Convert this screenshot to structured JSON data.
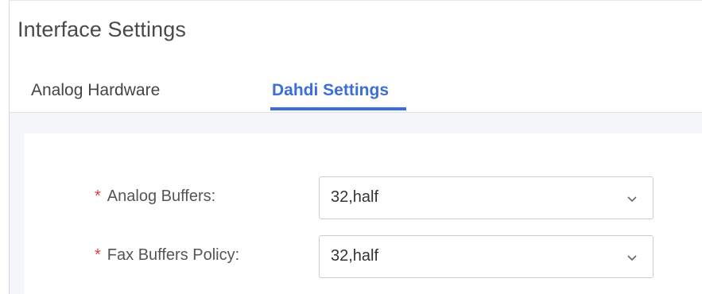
{
  "page": {
    "title": "Interface Settings"
  },
  "tabs": [
    {
      "label": "Analog Hardware",
      "active": false
    },
    {
      "label": "Dahdi Settings",
      "active": true
    }
  ],
  "form": {
    "required_mark": "*",
    "fields": [
      {
        "label": "Analog Buffers:",
        "value": "32,half"
      },
      {
        "label": "Fax Buffers Policy:",
        "value": "32,half"
      }
    ]
  },
  "colors": {
    "accent": "#3b6fd6",
    "required": "#e23a3a",
    "content_background": "#f4f6f9"
  },
  "icons": {
    "select_arrow": "chevron-down-icon"
  }
}
